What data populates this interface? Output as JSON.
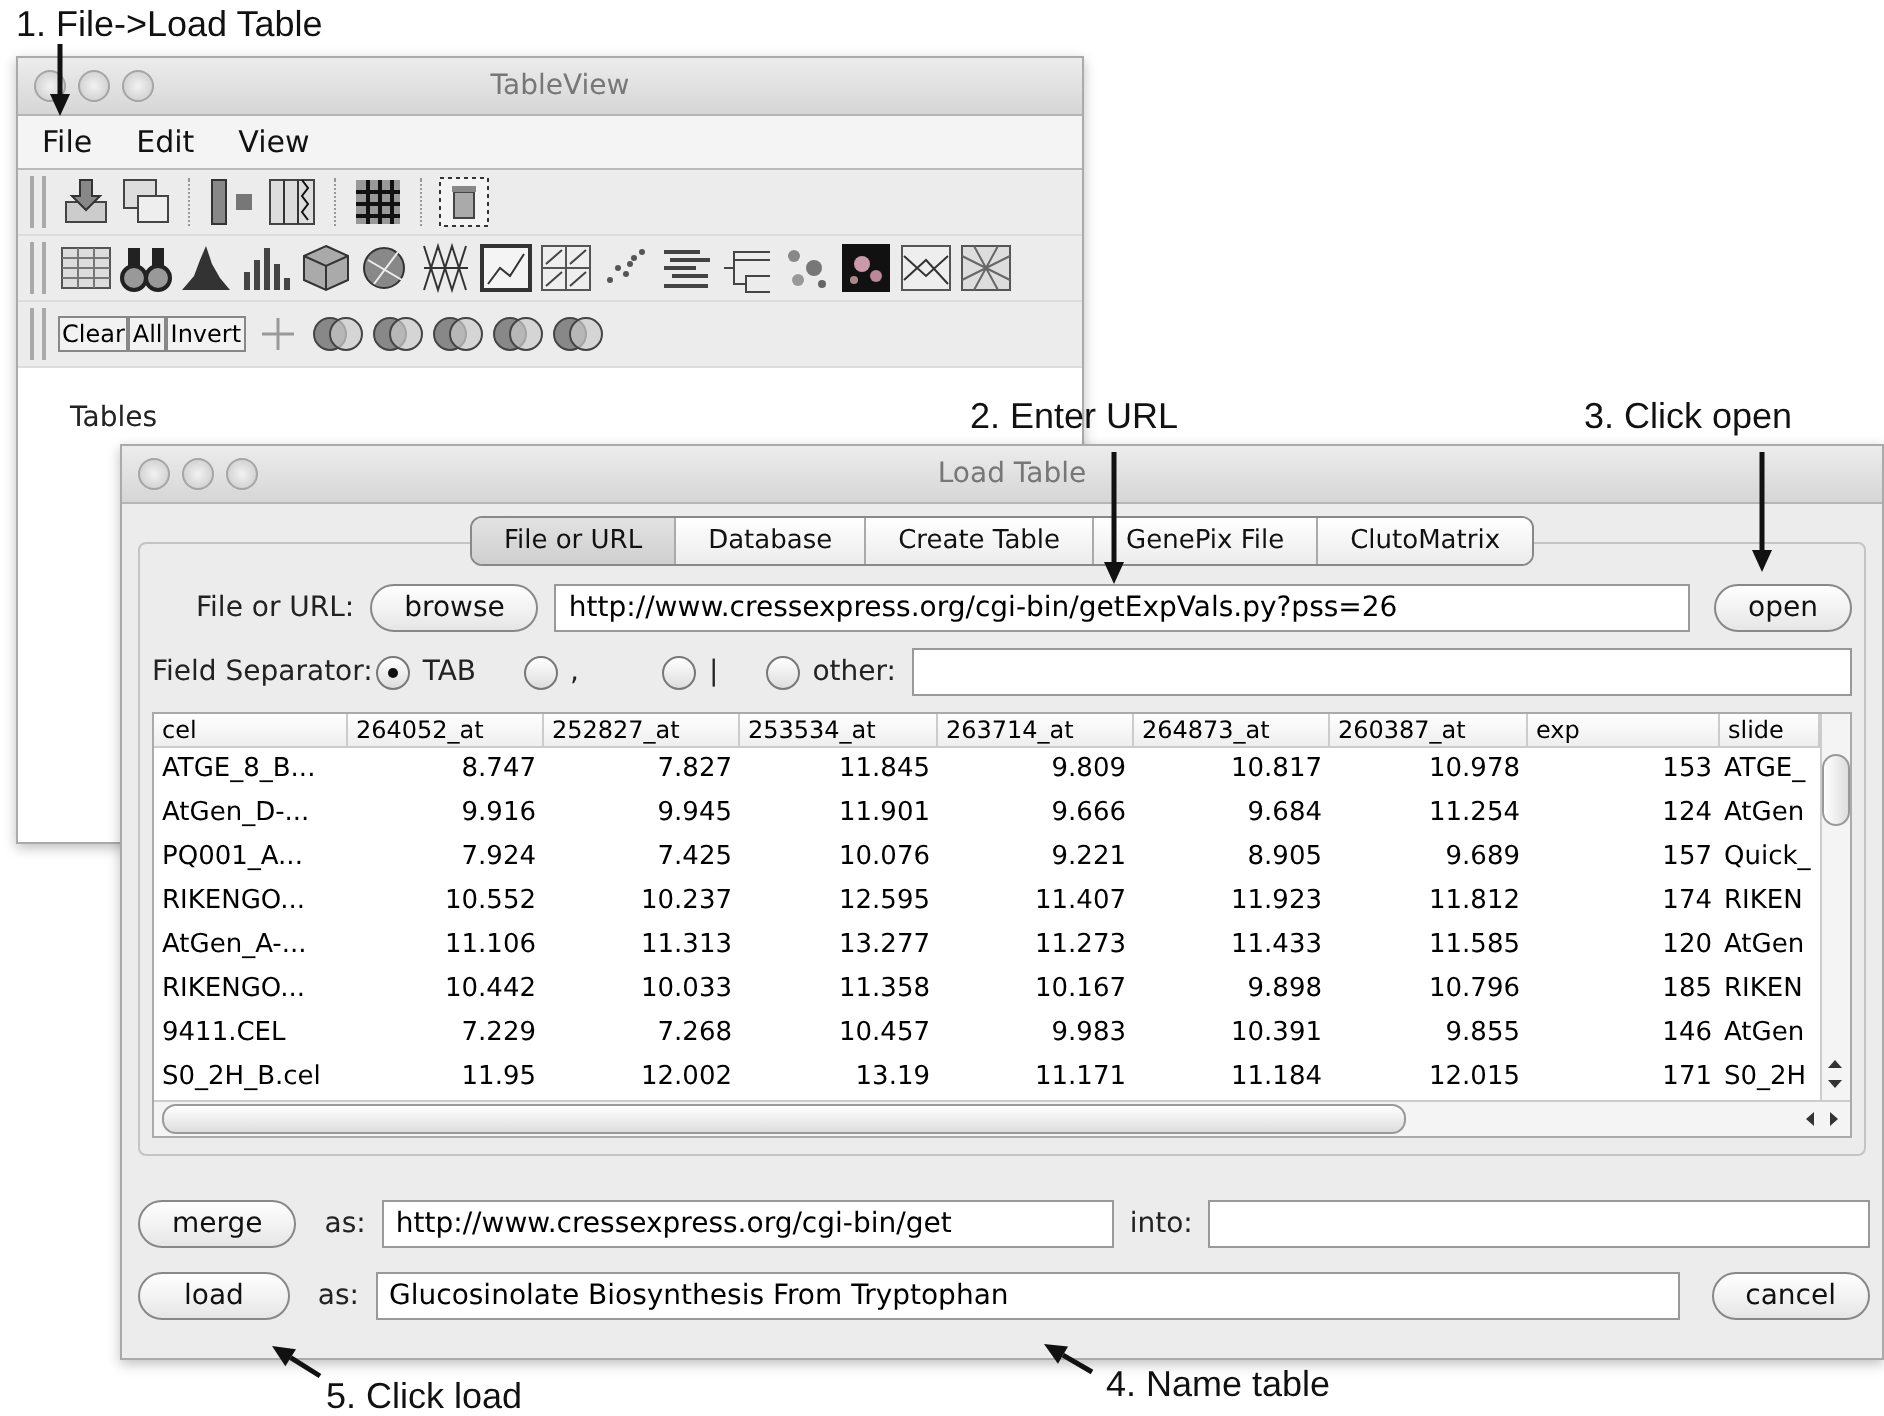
{
  "annotations": [
    {
      "text": "1. File->Load Table"
    },
    {
      "text": "2. Enter URL"
    },
    {
      "text": "3. Click open"
    },
    {
      "text": "4. Name table"
    },
    {
      "text": "5. Click load"
    }
  ],
  "table_view": {
    "title": "TableView",
    "menu": [
      "File",
      "Edit",
      "View"
    ],
    "selection_buttons": [
      "Clear",
      "All",
      "Invert"
    ],
    "tables_label": "Tables"
  },
  "load_table": {
    "title": "Load Table",
    "tabs": [
      {
        "label": "File or URL",
        "selected": true
      },
      {
        "label": "Database",
        "selected": false
      },
      {
        "label": "Create Table",
        "selected": false
      },
      {
        "label": "GenePix File",
        "selected": false
      },
      {
        "label": "ClutoMatrix",
        "selected": false
      }
    ],
    "file_label": "File or URL:",
    "browse_button": "browse",
    "url": "http://www.cressexpress.org/cgi-bin/getExpVals.py?pss=26",
    "open_button": "open",
    "separator_label": "Field Separator:",
    "separators": [
      {
        "label": "TAB",
        "selected": true
      },
      {
        "label": ",",
        "selected": false
      },
      {
        "label": "|",
        "selected": false
      },
      {
        "label": "other:",
        "selected": false
      }
    ],
    "table": {
      "columns": [
        "cel",
        "264052_at",
        "252827_at",
        "253534_at",
        "263714_at",
        "264873_at",
        "260387_at",
        "exp",
        "slide"
      ],
      "rows": [
        [
          "ATGE_8_B...",
          "8.747",
          "7.827",
          "11.845",
          "9.809",
          "10.817",
          "10.978",
          "153",
          "ATGE_"
        ],
        [
          "AtGen_D-...",
          "9.916",
          "9.945",
          "11.901",
          "9.666",
          "9.684",
          "11.254",
          "124",
          "AtGen"
        ],
        [
          "PQ001_A...",
          "7.924",
          "7.425",
          "10.076",
          "9.221",
          "8.905",
          "9.689",
          "157",
          "Quick_"
        ],
        [
          "RIKENGO...",
          "10.552",
          "10.237",
          "12.595",
          "11.407",
          "11.923",
          "11.812",
          "174",
          "RIKEN"
        ],
        [
          "AtGen_A-...",
          "11.106",
          "11.313",
          "13.277",
          "11.273",
          "11.433",
          "11.585",
          "120",
          "AtGen"
        ],
        [
          "RIKENGO...",
          "10.442",
          "10.033",
          "11.358",
          "10.167",
          "9.898",
          "10.796",
          "185",
          "RIKEN"
        ],
        [
          "9411.CEL",
          "7.229",
          "7.268",
          "10.457",
          "9.983",
          "10.391",
          "9.855",
          "146",
          "AtGen"
        ],
        [
          "S0_2H_B.cel",
          "11.95",
          "12.002",
          "13.19",
          "11.171",
          "11.184",
          "12.015",
          "171",
          "S0_2H"
        ]
      ]
    },
    "merge_button": "merge",
    "merge_as_label": "as:",
    "merge_as": "http://www.cressexpress.org/cgi-bin/get",
    "into_label": "into:",
    "load_button": "load",
    "load_as_label": "as:",
    "load_as": "Glucosinolate Biosynthesis From Tryptophan",
    "cancel_button": "cancel"
  }
}
